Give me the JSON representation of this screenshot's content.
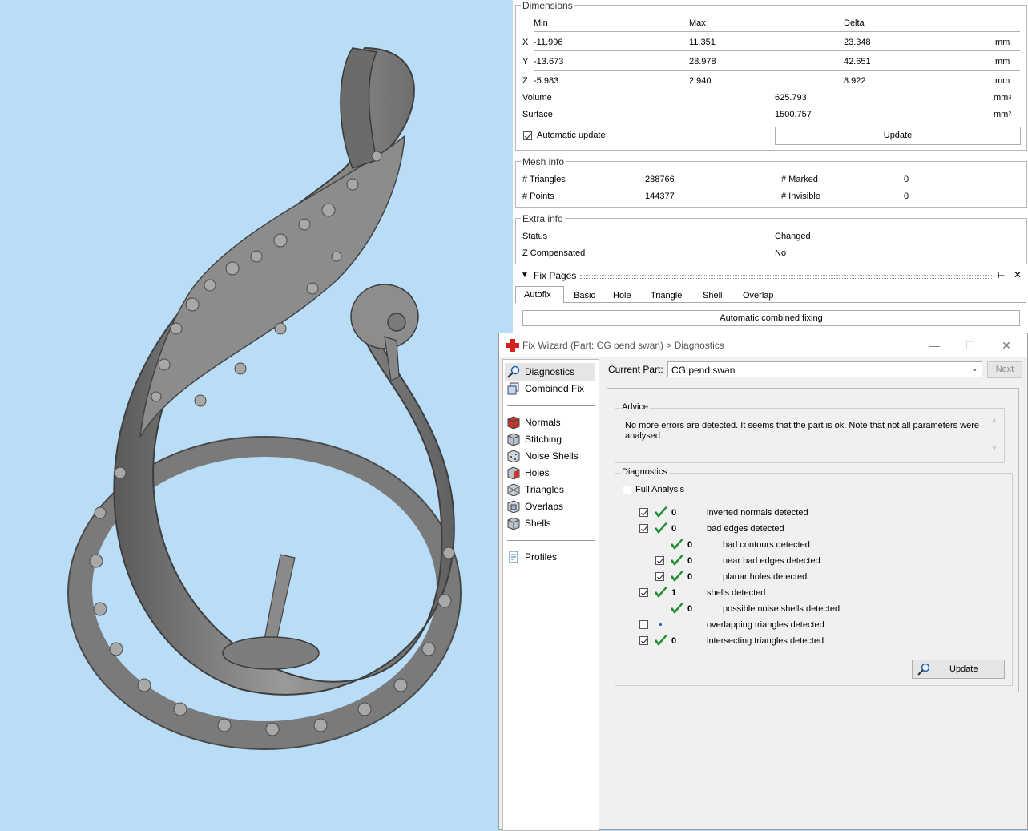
{
  "dimensions": {
    "title": "Dimensions",
    "headers": [
      "Min",
      "Max",
      "Delta"
    ],
    "rows": [
      {
        "axis": "X",
        "min": "-11.996",
        "max": "11.351",
        "delta": "23.348",
        "unit": "mm"
      },
      {
        "axis": "Y",
        "min": "-13.673",
        "max": "28.978",
        "delta": "42.651",
        "unit": "mm"
      },
      {
        "axis": "Z",
        "min": "-5.983",
        "max": "2.940",
        "delta": "8.922",
        "unit": "mm"
      }
    ],
    "volume_label": "Volume",
    "volume_value": "625.793",
    "volume_unit": "mm",
    "volume_exp": "3",
    "surface_label": "Surface",
    "surface_value": "1500.757",
    "surface_unit": "mm",
    "surface_exp": "2",
    "auto_update_label": "Automatic update",
    "auto_update_checked": true,
    "update_button": "Update"
  },
  "mesh_info": {
    "title": "Mesh info",
    "triangles_label": "# Triangles",
    "triangles_value": "288766",
    "points_label": "# Points",
    "points_value": "144377",
    "marked_label": "# Marked",
    "marked_value": "0",
    "invisible_label": "# Invisible",
    "invisible_value": "0"
  },
  "extra_info": {
    "title": "Extra info",
    "status_label": "Status",
    "status_value": "Changed",
    "zcomp_label": "Z Compensated",
    "zcomp_value": "No"
  },
  "fix_pages": {
    "title": "Fix Pages",
    "tabs": [
      "Autofix",
      "Basic",
      "Hole",
      "Triangle",
      "Shell",
      "Overlap"
    ],
    "active_tab": "Autofix",
    "auto_fix_button": "Automatic combined fixing"
  },
  "wizard": {
    "title": "Fix Wizard (Part: CG pend swan) > Diagnostics",
    "nav_top": [
      {
        "label": "Diagnostics",
        "icon": "magnifier-icon"
      },
      {
        "label": "Combined Fix",
        "icon": "combined-fix-icon"
      }
    ],
    "nav_steps": [
      {
        "label": "Normals",
        "icon": "normals-icon"
      },
      {
        "label": "Stitching",
        "icon": "stitching-icon"
      },
      {
        "label": "Noise Shells",
        "icon": "noise-shells-icon"
      },
      {
        "label": "Holes",
        "icon": "holes-icon"
      },
      {
        "label": "Triangles",
        "icon": "triangles-icon"
      },
      {
        "label": "Overlaps",
        "icon": "overlaps-icon"
      },
      {
        "label": "Shells",
        "icon": "shells-icon"
      }
    ],
    "nav_bottom": [
      {
        "label": "Profiles",
        "icon": "profiles-icon"
      }
    ],
    "current_part_label": "Current Part:",
    "current_part_value": "CG pend swan",
    "next_button": "Next",
    "advice_title": "Advice",
    "advice_text": "No more errors are detected. It seems that the part is ok. Note that not all parameters were analysed.",
    "diagnostics_title": "Diagnostics",
    "full_analysis_label": "Full Analysis",
    "full_analysis_checked": false,
    "rows": [
      {
        "checked": true,
        "has_box": true,
        "indent": 0,
        "ok": true,
        "value": "0",
        "label": "inverted normals detected"
      },
      {
        "checked": true,
        "has_box": true,
        "indent": 0,
        "ok": true,
        "value": "0",
        "label": "bad edges detected"
      },
      {
        "checked": false,
        "has_box": false,
        "indent": 1,
        "ok": true,
        "value": "0",
        "label": "bad contours detected"
      },
      {
        "checked": true,
        "has_box": true,
        "indent": 1,
        "ok": true,
        "value": "0",
        "label": "near bad edges detected"
      },
      {
        "checked": true,
        "has_box": true,
        "indent": 1,
        "ok": true,
        "value": "0",
        "label": "planar holes detected"
      },
      {
        "checked": true,
        "has_box": true,
        "indent": 0,
        "ok": true,
        "value": "1",
        "label": "shells detected"
      },
      {
        "checked": false,
        "has_box": false,
        "indent": 1,
        "ok": true,
        "value": "0",
        "label": "possible noise shells detected"
      },
      {
        "checked": false,
        "has_box": true,
        "indent": 0,
        "ok": false,
        "value": "",
        "label": "overlapping triangles detected"
      },
      {
        "checked": true,
        "has_box": true,
        "indent": 0,
        "ok": true,
        "value": "0",
        "label": "intersecting triangles detected"
      }
    ],
    "update_button": "Update"
  }
}
